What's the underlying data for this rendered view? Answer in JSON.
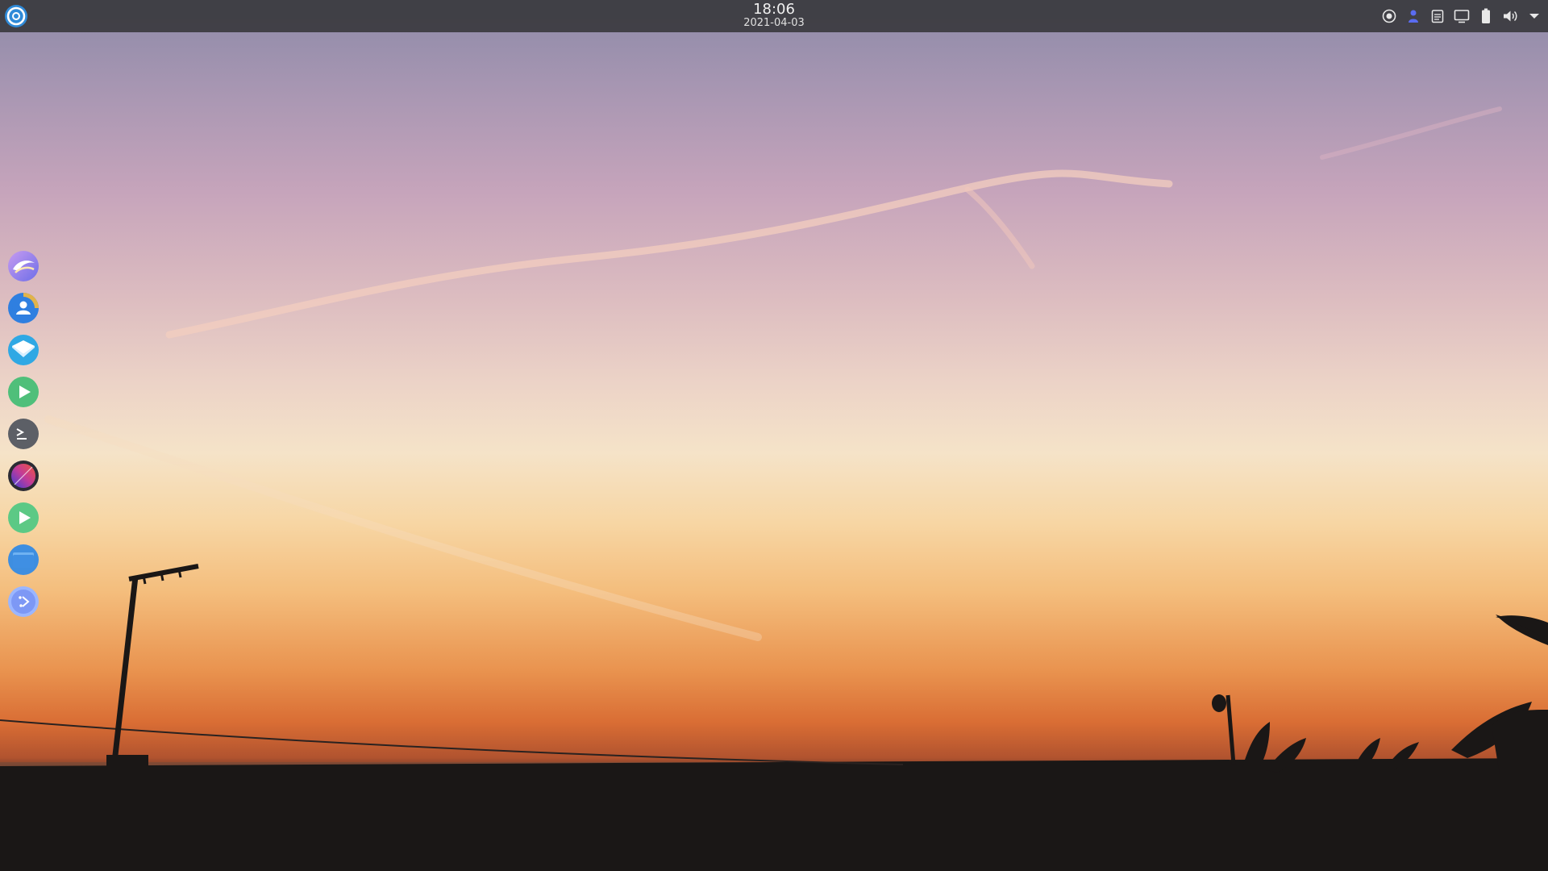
{
  "panel": {
    "start_menu_icon": "distro-logo-icon",
    "clock": {
      "time": "18:06",
      "date": "2021-04-03"
    },
    "tray": [
      {
        "icon": "screenshot-icon"
      },
      {
        "icon": "user-icon"
      },
      {
        "icon": "clipboard-icon"
      },
      {
        "icon": "display-icon"
      },
      {
        "icon": "battery-icon"
      },
      {
        "icon": "volume-icon"
      },
      {
        "icon": "chevron-down-icon"
      }
    ]
  },
  "dock": {
    "items": [
      {
        "icon": "web-browser-icon"
      },
      {
        "icon": "contacts-icon"
      },
      {
        "icon": "mail-icon"
      },
      {
        "icon": "media-player-icon"
      },
      {
        "icon": "terminal-icon"
      },
      {
        "icon": "color-picker-icon"
      },
      {
        "icon": "video-player-icon"
      },
      {
        "icon": "file-manager-icon"
      },
      {
        "icon": "settings-icon"
      }
    ]
  },
  "colors": {
    "panel_bg": "#3a3a3e",
    "accent_blue": "#3e8ee0",
    "accent_green": "#4fbf7a"
  }
}
